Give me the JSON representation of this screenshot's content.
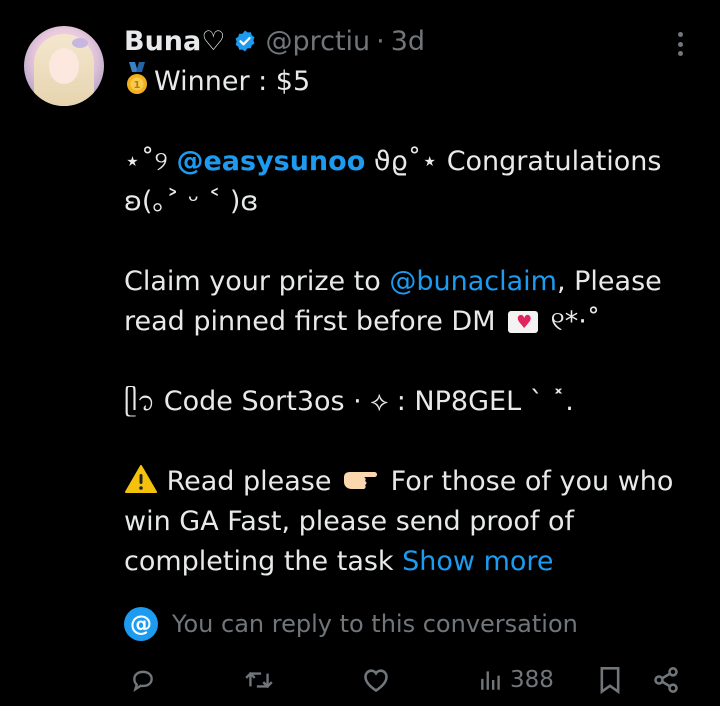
{
  "tweet": {
    "author_name": "Buna♡",
    "handle": "@prctiu",
    "separator": "·",
    "time": "3d",
    "lines": {
      "winner": "Winner : $5",
      "line2_prefix": "⋆˚୨ ",
      "mention1": "@easysunoo",
      "line2_suffix": " ϑϱ˚⋆ Congratulations",
      "line3": "ʚ(｡˃ ᵕ ˂ )ɞ",
      "line5_prefix": "Claim your prize to ",
      "mention2": "@bunaclaim",
      "line5_suffix": ", Please",
      "line6_prefix": "read pinned first before DM ",
      "line6_suffix": " ୧*·˚",
      "line8": "ᥫ᭡ Code Sort3os · ⟡ : NP8GEL  ˋ  ˟.",
      "line10_prefix": " Read please ",
      "line10_suffix": " For those of you who",
      "line11": "win GA Fast, please send proof of",
      "line12_prefix": "completing the task ",
      "show_more": "Show more"
    },
    "reply_note": "You can reply to this conversation",
    "views": "388"
  },
  "icons": {
    "reply": "reply-icon",
    "retweet": "retweet-icon",
    "like": "like-icon",
    "views": "views-icon",
    "bookmark": "bookmark-icon",
    "share": "share-icon"
  },
  "colors": {
    "accent": "#1d9bf0",
    "muted": "#71767b",
    "text": "#e7e9ea",
    "background": "#000000"
  }
}
